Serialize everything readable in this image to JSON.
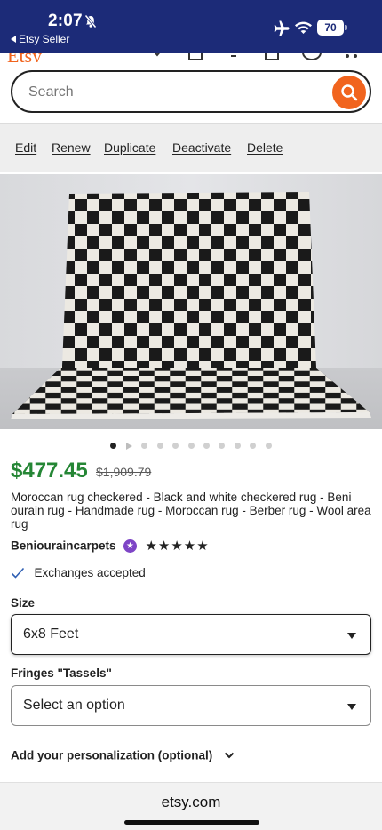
{
  "status_bar": {
    "time": "2:07",
    "back_label": "Etsy Seller",
    "battery": "70",
    "bg_color": "#1c2b78"
  },
  "search": {
    "placeholder": "Search",
    "button_color": "#f1641e"
  },
  "actions": [
    "Edit",
    "Renew",
    "Duplicate",
    "Deactivate",
    "Delete"
  ],
  "carousel": {
    "total": 11,
    "current": 1,
    "second_is_video": true
  },
  "listing": {
    "price": "$477.45",
    "original_price": "$1,909.79",
    "price_color": "#258635",
    "title": "Moroccan rug checkered - Black and white checkered rug - Beni ourain rug - Handmade rug - Moroccan rug - Berber rug - Wool area rug",
    "shop_name": "Beniouraincarpets",
    "rating_stars": "★★★★★",
    "rating": 5,
    "exchange": "Exchanges accepted"
  },
  "options": {
    "size_label": "Size",
    "size_value": "6x8 Feet",
    "fringes_label": "Fringes \"Tassels\"",
    "fringes_value": "Select an option"
  },
  "personalization": {
    "label": "Add your personalization (optional)"
  },
  "browser": {
    "url": "etsy.com"
  }
}
